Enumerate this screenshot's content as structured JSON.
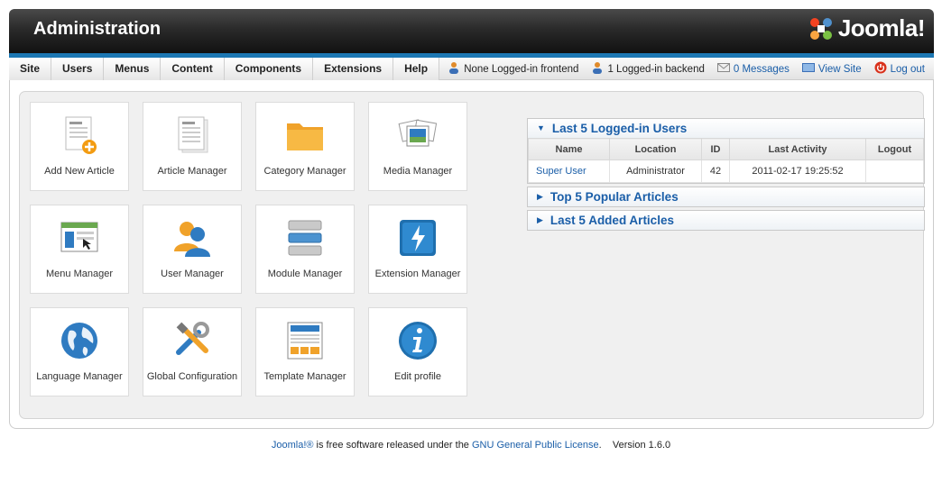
{
  "header": {
    "title": "Administration",
    "logo_text": "Joomla!"
  },
  "menu": {
    "items": [
      "Site",
      "Users",
      "Menus",
      "Content",
      "Components",
      "Extensions",
      "Help"
    ]
  },
  "status": {
    "frontend": "None Logged-in frontend",
    "backend": "1 Logged-in backend",
    "messages": "0 Messages",
    "view_site": "View Site",
    "logout": "Log out"
  },
  "tiles": [
    {
      "label": "Add New Article",
      "icon": "add-article-icon"
    },
    {
      "label": "Article Manager",
      "icon": "article-manager-icon"
    },
    {
      "label": "Category Manager",
      "icon": "folder-icon"
    },
    {
      "label": "Media Manager",
      "icon": "media-icon"
    },
    {
      "label": "Menu Manager",
      "icon": "menu-icon"
    },
    {
      "label": "User Manager",
      "icon": "users-icon"
    },
    {
      "label": "Module Manager",
      "icon": "module-icon"
    },
    {
      "label": "Extension Manager",
      "icon": "extension-icon"
    },
    {
      "label": "Language Manager",
      "icon": "globe-icon"
    },
    {
      "label": "Global Configuration",
      "icon": "tools-icon"
    },
    {
      "label": "Template Manager",
      "icon": "template-icon"
    },
    {
      "label": "Edit profile",
      "icon": "info-icon"
    }
  ],
  "modules": {
    "logged_in": {
      "title": "Last 5 Logged-in Users",
      "columns": [
        "Name",
        "Location",
        "ID",
        "Last Activity",
        "Logout"
      ],
      "rows": [
        {
          "name": "Super User",
          "location": "Administrator",
          "id": "42",
          "last_activity": "2011-02-17 19:25:52",
          "logout": ""
        }
      ]
    },
    "popular": {
      "title": "Top 5 Popular Articles"
    },
    "added": {
      "title": "Last 5 Added Articles"
    }
  },
  "footer": {
    "brand": "Joomla!®",
    "text1": " is free software released under the ",
    "license": "GNU General Public License",
    "text2": ".",
    "version": "Version 1.6.0"
  },
  "colors": {
    "accent": "#1c77b3",
    "link": "#1a5ea8"
  }
}
